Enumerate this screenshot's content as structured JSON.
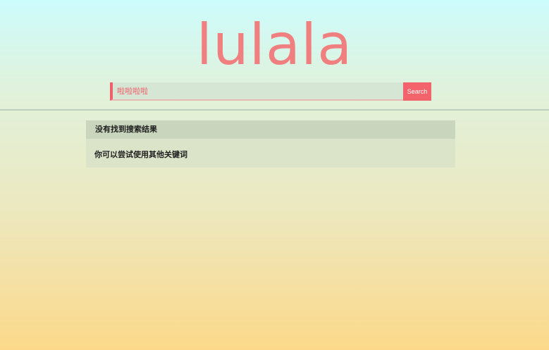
{
  "logo": {
    "text": "lulala"
  },
  "search": {
    "value": "啦啦啦啦",
    "button_label": "Search"
  },
  "result": {
    "header": "没有找到搜索结果",
    "message": "你可以尝试使用其他关键词"
  },
  "colors": {
    "accent": "#f2636b",
    "logo": "#f07f80",
    "background_top": "#ccfcfc",
    "background_bottom": "#fcd98a"
  }
}
